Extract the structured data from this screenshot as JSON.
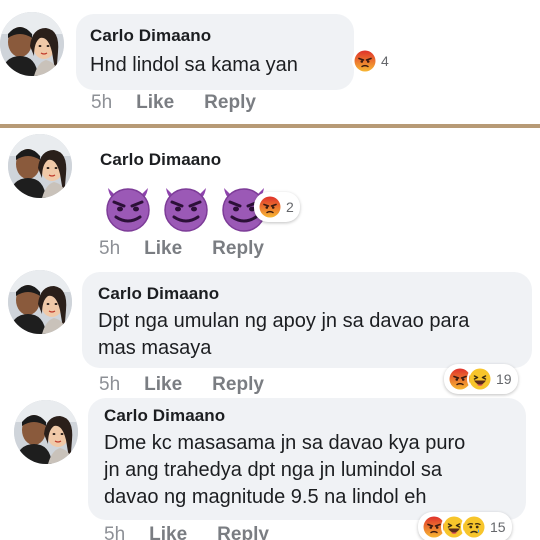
{
  "comments": [
    {
      "author": "Carlo Dimaano",
      "text": "Hnd lindol sa kama yan",
      "time": "5h",
      "like_label": "Like",
      "reply_label": "Reply",
      "reaction_icons": [
        "angry-icon"
      ],
      "reaction_count": "4"
    },
    {
      "author": "Carlo Dimaano",
      "emojis": [
        "smiling-devil-icon",
        "smiling-devil-icon",
        "smiling-devil-icon"
      ],
      "time": "5h",
      "like_label": "Like",
      "reply_label": "Reply",
      "reaction_icons": [
        "angry-icon"
      ],
      "reaction_count": "2"
    },
    {
      "author": "Carlo Dimaano",
      "text_lines": [
        "Dpt nga umulan ng apoy jn sa davao para",
        "mas masaya"
      ],
      "time": "5h",
      "like_label": "Like",
      "reply_label": "Reply",
      "reaction_icons": [
        "angry-icon",
        "laughing-icon"
      ],
      "reaction_count": "19"
    },
    {
      "author": "Carlo Dimaano",
      "text_lines": [
        "Dme kc masasama jn sa davao kya puro",
        "jn ang trahedya dpt nga jn lumindol sa",
        "davao ng magnitude 9.5 na lindol eh"
      ],
      "time": "5h",
      "like_label": "Like",
      "reply_label": "Reply",
      "reaction_icons": [
        "angry-icon",
        "laughing-icon",
        "sad-icon"
      ],
      "reaction_count": "15"
    }
  ],
  "colors": {
    "bubble": "#f0f2f5",
    "meta": "#7a7d82",
    "divider": "#b79a76",
    "devil": "#8e44ad",
    "angry": "#e8542a",
    "haha": "#f7c52b"
  }
}
